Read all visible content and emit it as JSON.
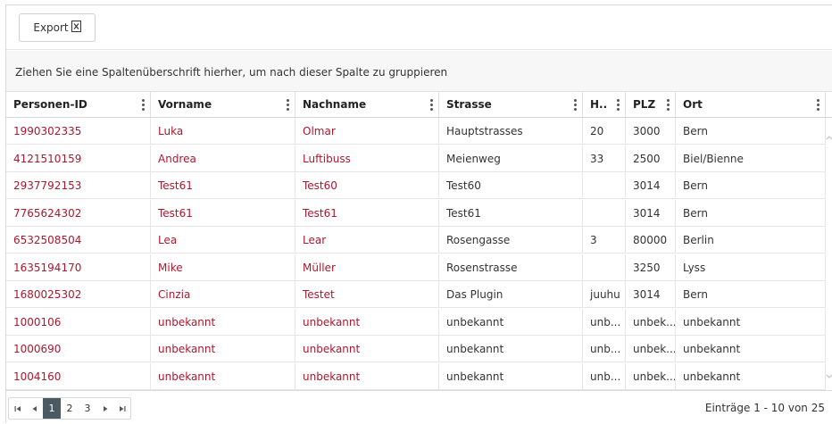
{
  "toolbar": {
    "export_label": "Export"
  },
  "group_hint": "Ziehen Sie eine Spaltenüberschrift hierher, um nach dieser Spalte zu gruppieren",
  "columns": [
    "Personen-ID",
    "Vorname",
    "Nachname",
    "Strasse",
    "H..",
    "PLZ",
    "Ort"
  ],
  "rows": [
    [
      "1990302335",
      "Luka",
      "Olmar",
      "Hauptstrasses",
      "20",
      "3000",
      "Bern"
    ],
    [
      "4121510159",
      "Andrea",
      "Luftibuss",
      "Meienweg",
      "33",
      "2500",
      "Biel/Bienne"
    ],
    [
      "2937792153",
      "Test61",
      "Test60",
      "Test60",
      "",
      "3014",
      "Bern"
    ],
    [
      "7765624302",
      "Test61",
      "Test61",
      "Test61",
      "",
      "3014",
      "Bern"
    ],
    [
      "6532508504",
      "Lea",
      "Lear",
      "Rosengasse",
      "3",
      "80000",
      "Berlin"
    ],
    [
      "1635194170",
      "Mike",
      "Müller",
      "Rosenstrasse",
      "",
      "3250",
      "Lyss"
    ],
    [
      "1680025302",
      "Cinzia",
      "Testet",
      "Das Plugin",
      "juuhu",
      "3014",
      "Bern"
    ],
    [
      "1000106",
      "unbekannt",
      "unbekannt",
      "unbekannt",
      "unb...",
      "unbek...",
      "unbekannt"
    ],
    [
      "1000690",
      "unbekannt",
      "unbekannt",
      "unbekannt",
      "unb...",
      "unbek...",
      "unbekannt"
    ],
    [
      "1004160",
      "unbekannt",
      "unbekannt",
      "unbekannt",
      "unb...",
      "unbek...",
      "unbekannt"
    ]
  ],
  "pager": {
    "first": "⏮",
    "prev": "◀",
    "pages": [
      "1",
      "2",
      "3"
    ],
    "current": "1",
    "next": "▶",
    "last": "⏭",
    "info": "Einträge 1 - 10 von 25"
  },
  "colors": {
    "link": "#a8192e",
    "active_page": "#4a5a63"
  }
}
